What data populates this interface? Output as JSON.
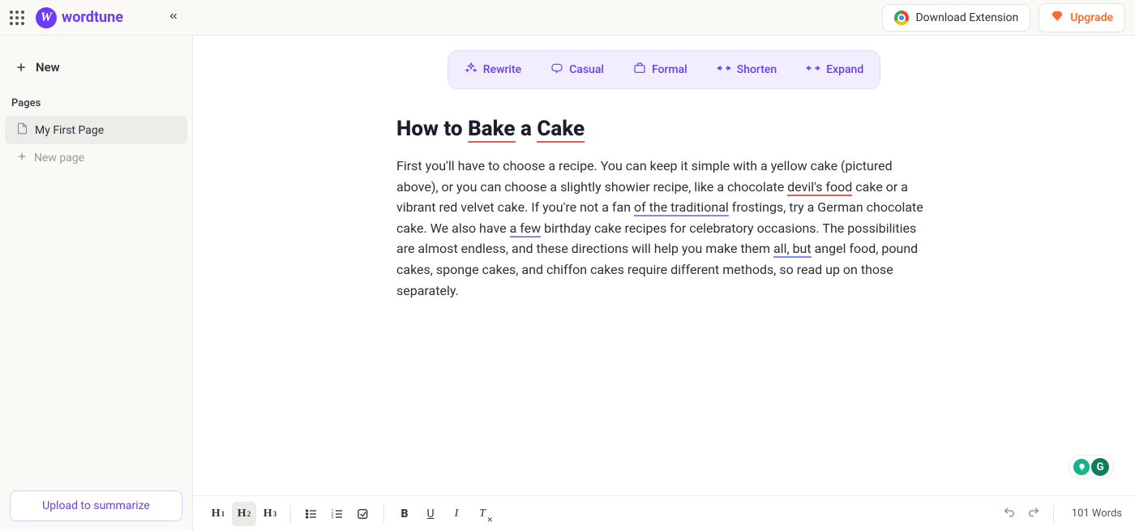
{
  "header": {
    "brand": "wordtune",
    "download_label": "Download Extension",
    "upgrade_label": "Upgrade"
  },
  "sidebar": {
    "new_label": "New",
    "section_label": "Pages",
    "pages": [
      {
        "label": "My First Page",
        "active": true
      }
    ],
    "new_page_label": "New page",
    "upload_label": "Upload to summarize"
  },
  "rewrite_toolbar": {
    "rewrite": "Rewrite",
    "casual": "Casual",
    "formal": "Formal",
    "shorten": "Shorten",
    "expand": "Expand"
  },
  "document": {
    "title_parts": {
      "t1": "How to ",
      "t2": "Bake",
      "t3": " a ",
      "t4": "Cake"
    },
    "body_parts": {
      "p1": "First you'll have to choose a recipe. You can keep it simple with a yellow cake (pictured above), or you can choose a slightly showier recipe, like a chocolate ",
      "p2": "devil's food",
      "p3": " cake or a vibrant red velvet cake. If you're not a fan ",
      "p4": "of the traditional",
      "p5": " frostings, try a German chocolate cake. We also have ",
      "p6": "a few",
      "p7": " birthday cake recipes for celebratory occasions. The possibilities are almost endless, and these directions will help you make them ",
      "p8": "all, but",
      "p9": " angel food, pound cakes, sponge cakes, and chiffon cakes require different methods, so read up on those separately."
    }
  },
  "bottom_bar": {
    "h1": "H",
    "h1s": "1",
    "h2": "H",
    "h2s": "2",
    "h3": "H",
    "h3s": "3",
    "bold": "B",
    "underline": "U",
    "italic": "I",
    "word_count": "101 Words"
  },
  "grammarly": {
    "g": "G"
  }
}
